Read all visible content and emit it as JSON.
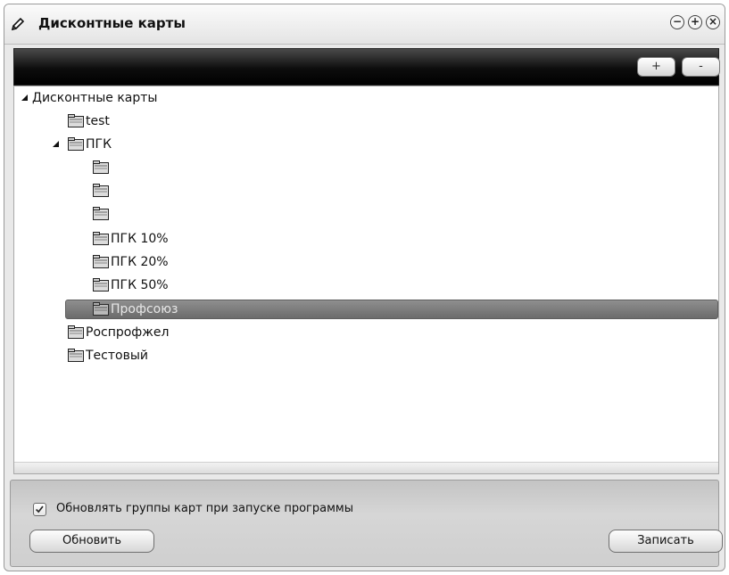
{
  "window": {
    "title": "Дисконтные карты",
    "title_icon": "pencil-icon",
    "controls": [
      "minimize-icon",
      "maximize-icon",
      "close-icon"
    ]
  },
  "toolbar": {
    "add_label": "+",
    "remove_label": "-"
  },
  "tree": {
    "root": {
      "label": "Дисконтные карты",
      "expanded": true
    },
    "items": [
      {
        "label": "test",
        "level": 1
      },
      {
        "label": "ПГК",
        "level": 1,
        "expanded": true
      },
      {
        "label": "",
        "level": 2
      },
      {
        "label": "",
        "level": 2
      },
      {
        "label": "",
        "level": 2
      },
      {
        "label": "ПГК 10%",
        "level": 2
      },
      {
        "label": "ПГК 20%",
        "level": 2
      },
      {
        "label": "ПГК 50%",
        "level": 2
      },
      {
        "label": "Профсоюз",
        "level": 2,
        "selected": true
      },
      {
        "label": "Роспрофжел",
        "level": 1
      },
      {
        "label": "Тестовый",
        "level": 1
      }
    ]
  },
  "options": {
    "update_groups_label": "Обновлять группы карт при запуске программы",
    "update_groups_checked": true
  },
  "actions": {
    "refresh_label": "Обновить",
    "save_label": "Записать"
  },
  "colors": {
    "toolbar_bg": "#111111",
    "selection_bg": "#7a7a7a",
    "panel_bg": "#d2d2d2"
  }
}
